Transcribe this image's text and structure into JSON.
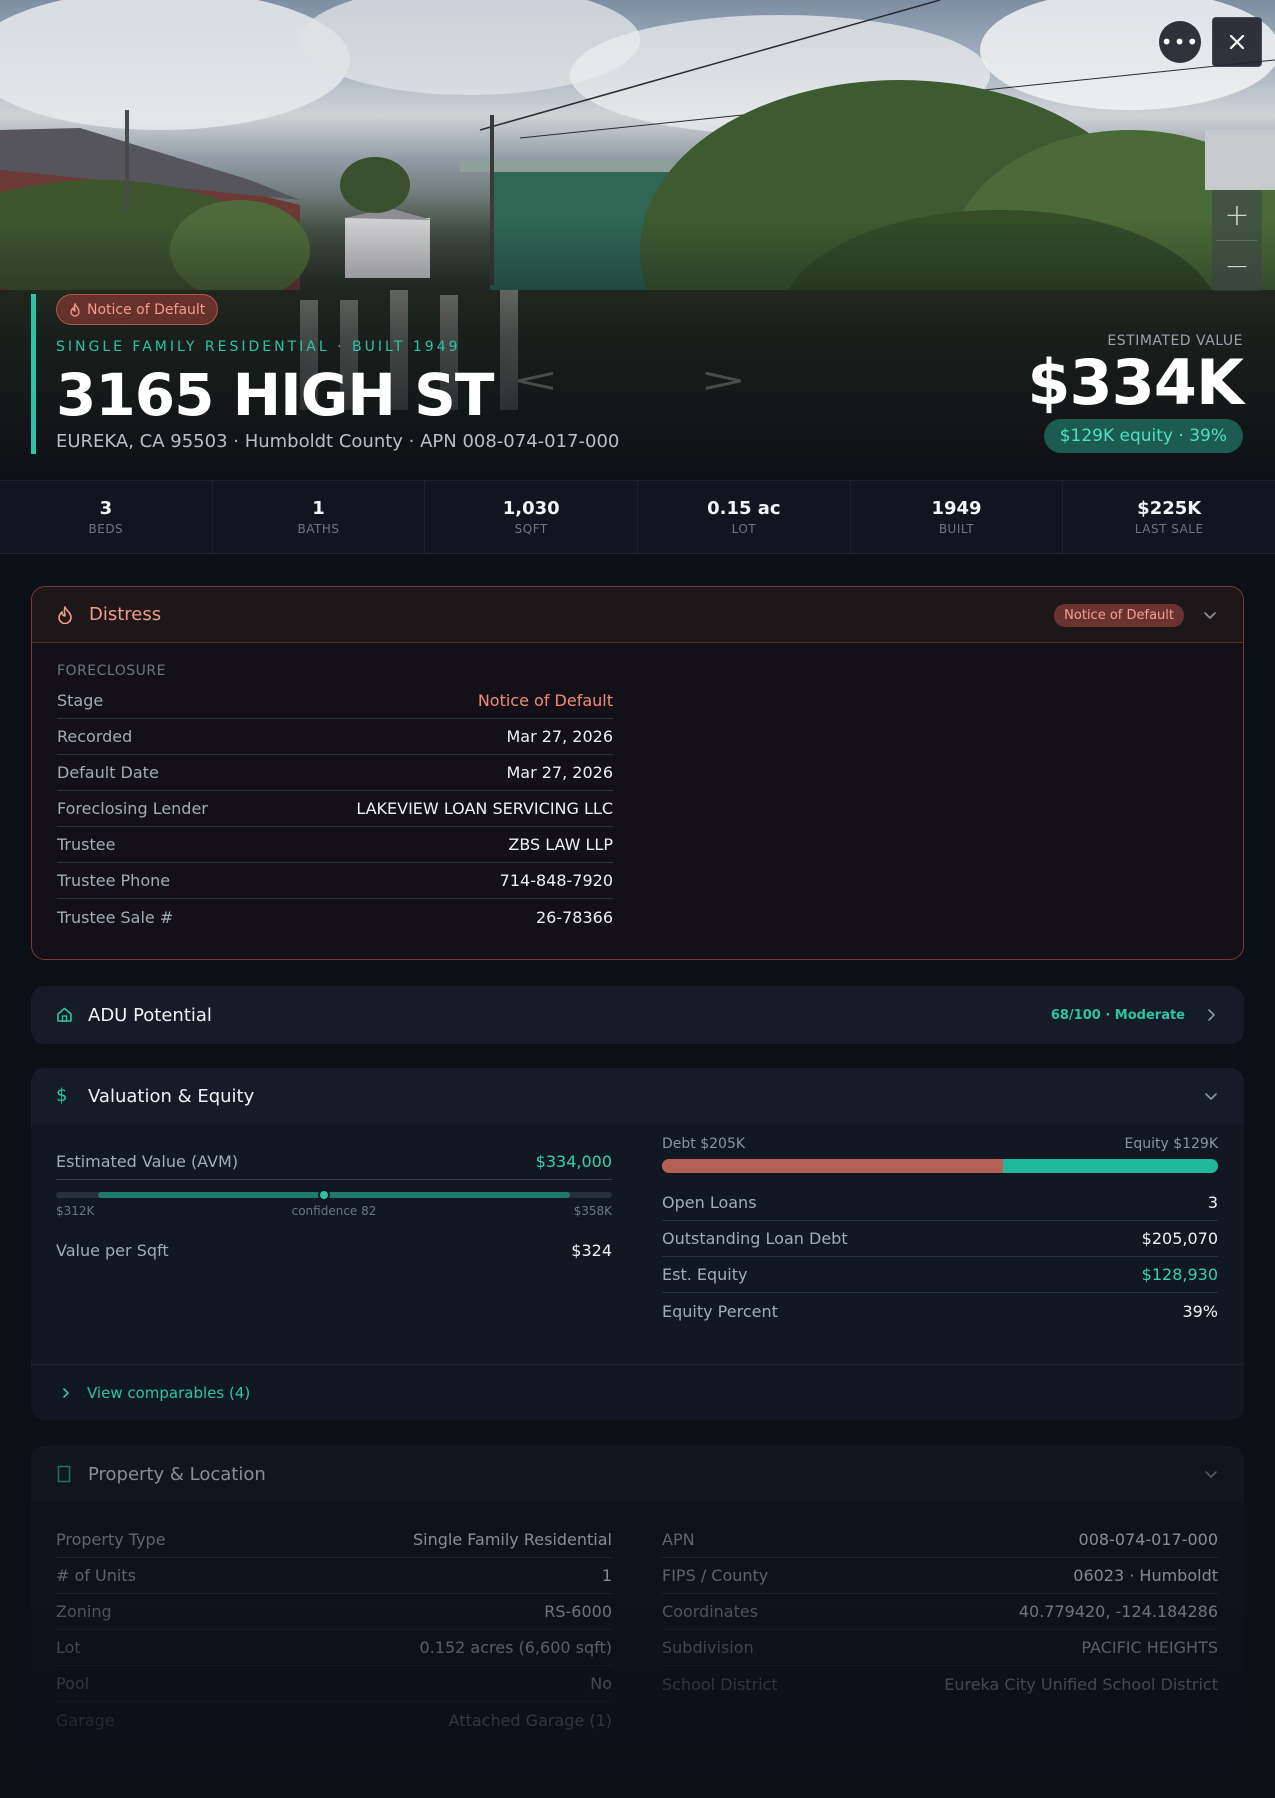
{
  "hero": {
    "distress_tag": "Notice of Default",
    "eyebrow": "SINGLE FAMILY RESIDENTIAL · BUILT 1949",
    "address": "3165 HIGH ST",
    "subline": "EUREKA, CA 95503 · Humboldt County · APN 008-074-017-000",
    "estimated_label": "ESTIMATED VALUE",
    "estimated_value": "$334K",
    "equity_pill": "$129K equity · 39%",
    "more_icon": "ellipsis-icon",
    "close_icon": "close-icon",
    "zoom_in": "+",
    "zoom_out": "−",
    "prev_arrow": "<",
    "next_arrow": ">"
  },
  "stats": [
    {
      "value": "3",
      "label": "BEDS"
    },
    {
      "value": "1",
      "label": "BATHS"
    },
    {
      "value": "1,030",
      "label": "SQFT"
    },
    {
      "value": "0.15 ac",
      "label": "LOT"
    },
    {
      "value": "1949",
      "label": "BUILT"
    },
    {
      "value": "$225K",
      "label": "LAST SALE"
    }
  ],
  "distress": {
    "title": "Distress",
    "badge": "Notice of Default",
    "section": "FORECLOSURE",
    "rows": [
      {
        "key": "Stage",
        "value": "Notice of Default"
      },
      {
        "key": "Recorded",
        "value": "Mar 27, 2026"
      },
      {
        "key": "Default Date",
        "value": "Mar 27, 2026"
      },
      {
        "key": "Foreclosing Lender",
        "value": "LAKEVIEW LOAN SERVICING LLC"
      },
      {
        "key": "Trustee",
        "value": "ZBS LAW LLP"
      },
      {
        "key": "Trustee Phone",
        "value": "714-848-7920"
      },
      {
        "key": "Trustee Sale #",
        "value": "26-78366"
      }
    ]
  },
  "adu": {
    "title": "ADU Potential",
    "badge": "68/100 · Moderate"
  },
  "valuation": {
    "title": "Valuation & Equity",
    "avm_label": "Estimated Value (AVM)",
    "avm_value": "$334,000",
    "range_low": "$312K",
    "range_mid": "confidence 82",
    "range_high": "$358K",
    "range_low_value": 312000,
    "range_high_value": 358000,
    "point_value": 334000,
    "vps_label": "Value per Sqft",
    "vps_value": "$324",
    "debt_label": "Debt $205K",
    "equity_label": "Equity $129K",
    "debt_fraction": 0.614,
    "rows": [
      {
        "key": "Open Loans",
        "value": "3"
      },
      {
        "key": "Outstanding Loan Debt",
        "value": "$205,070"
      },
      {
        "key": "Est. Equity",
        "value": "$128,930"
      },
      {
        "key": "Equity Percent",
        "value": "39%"
      }
    ],
    "comps_link": "View comparables (4)"
  },
  "property": {
    "title": "Property & Location",
    "left_rows": [
      {
        "key": "Property Type",
        "value": "Single Family Residential"
      },
      {
        "key": "# of Units",
        "value": "1"
      },
      {
        "key": "Zoning",
        "value": "RS-6000"
      },
      {
        "key": "Lot",
        "value": "0.152 acres (6,600 sqft)"
      },
      {
        "key": "Pool",
        "value": "No"
      },
      {
        "key": "Garage",
        "value": "Attached Garage (1)"
      }
    ],
    "right_rows": [
      {
        "key": "APN",
        "value": "008-074-017-000"
      },
      {
        "key": "FIPS / County",
        "value": "06023 · Humboldt"
      },
      {
        "key": "Coordinates",
        "value": "40.779420, -124.184286"
      },
      {
        "key": "Subdivision",
        "value": "PACIFIC HEIGHTS"
      },
      {
        "key": "School District",
        "value": "Eureka City Unified School District"
      }
    ]
  },
  "colors": {
    "accent": "#2bc4a6",
    "distress": "#f29b8c",
    "debt": "#b46056",
    "equity": "#1fb89c",
    "background": "#0b0f16"
  }
}
